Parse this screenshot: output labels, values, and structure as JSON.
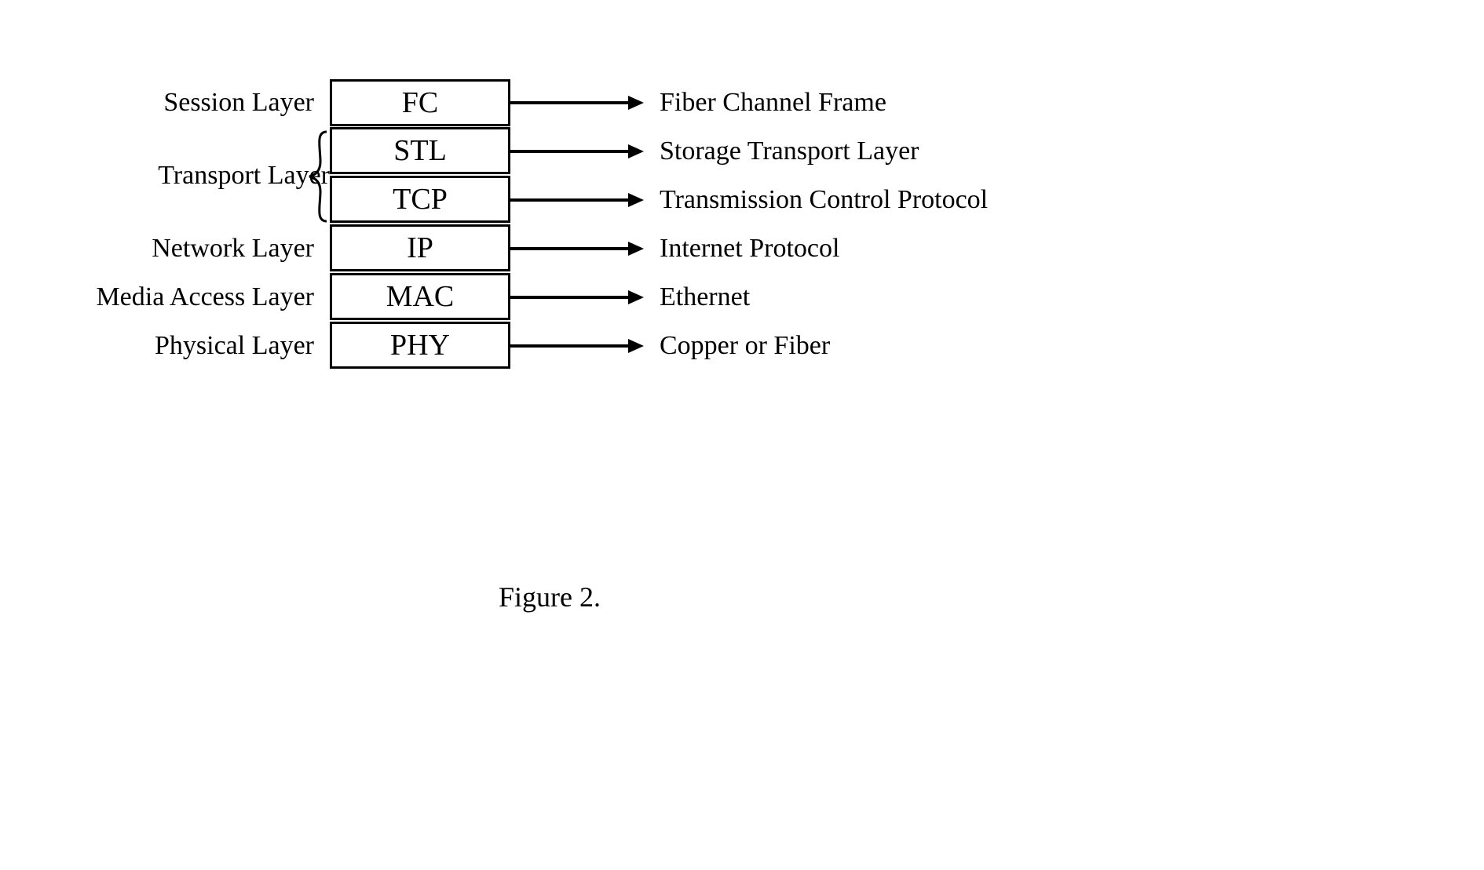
{
  "caption": "Figure 2.",
  "layers": {
    "session": {
      "label": "Session Layer",
      "abbr": "FC",
      "desc": "Fiber Channel Frame"
    },
    "transport": {
      "label": "Transport Layer"
    },
    "stl": {
      "abbr": "STL",
      "desc": "Storage Transport Layer"
    },
    "tcp": {
      "abbr": "TCP",
      "desc": "Transmission Control Protocol"
    },
    "network": {
      "label": "Network Layer",
      "abbr": "IP",
      "desc": "Internet Protocol"
    },
    "media": {
      "label": "Media Access Layer",
      "abbr": "MAC",
      "desc": "Ethernet"
    },
    "physical": {
      "label": "Physical Layer",
      "abbr": "PHY",
      "desc": "Copper or Fiber"
    }
  }
}
